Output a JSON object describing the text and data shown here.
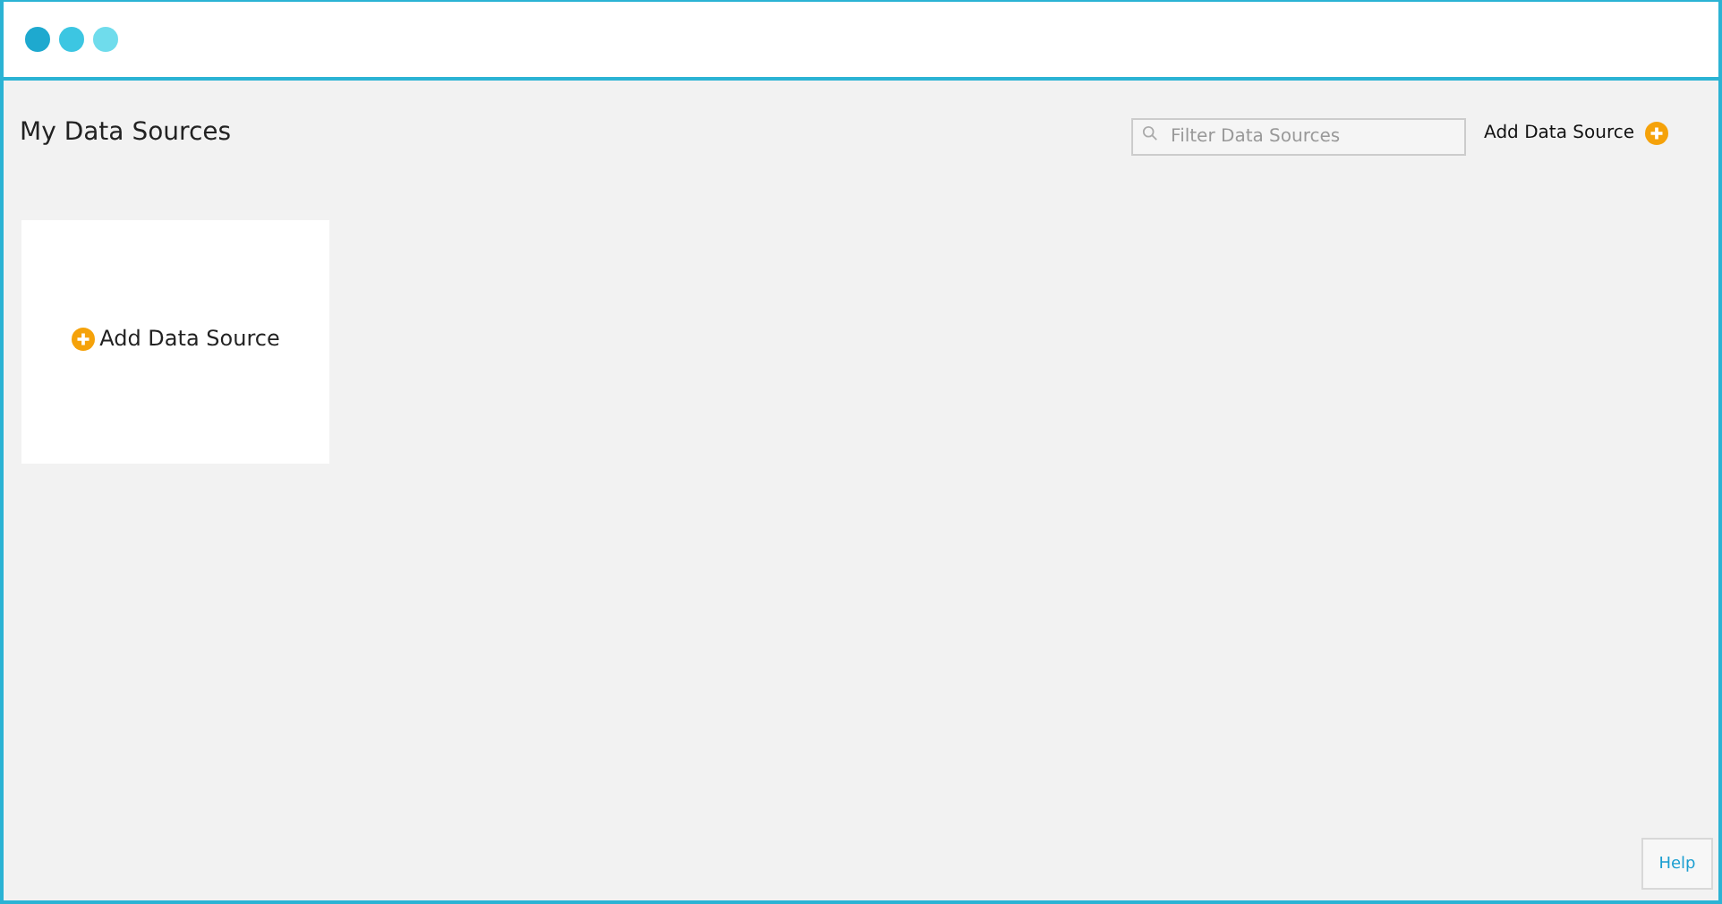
{
  "window": {
    "controls": [
      {
        "color": "#1ea9cf"
      },
      {
        "color": "#3cc6e2"
      },
      {
        "color": "#6fdcec"
      }
    ]
  },
  "header": {
    "title": "My Data Sources",
    "search": {
      "placeholder": "Filter Data Sources"
    },
    "add_button": "Add Data Source"
  },
  "card": {
    "label": "Add Data Source"
  },
  "help_button": "Help"
}
